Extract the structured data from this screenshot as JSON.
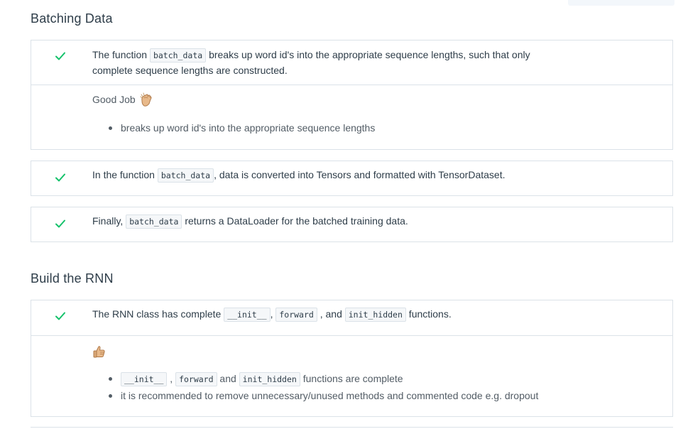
{
  "sections": [
    {
      "title": "Batching Data",
      "criteria": [
        {
          "parts": [
            "The function ",
            "batch_data",
            " breaks up word id's into the appropriate sequence lengths, such that only complete sequence lengths are constructed."
          ],
          "review": {
            "note": "Good Job",
            "note_emoji": "clapping-hands-icon",
            "bullets": [
              "breaks up word id's into the appropriate sequence lengths"
            ]
          }
        },
        {
          "parts": [
            "In the function ",
            "batch_data",
            ", data is converted into Tensors and formatted with TensorDataset."
          ]
        },
        {
          "parts": [
            "Finally, ",
            "batch_data",
            " returns a DataLoader for the batched training data."
          ]
        }
      ]
    },
    {
      "title": "Build the RNN",
      "criteria": [
        {
          "parts": [
            "The RNN class has complete ",
            "__init__",
            ", ",
            "forward",
            " , and ",
            "init_hidden",
            " functions."
          ],
          "review": {
            "note_emoji": "thumbs-up-icon",
            "bullets": [
              {
                "parts": [
                  "__init__",
                  " , ",
                  "forward",
                  " and ",
                  "init_hidden",
                  " functions are complete"
                ]
              },
              "it is recommended to remove unnecessary/unused methods and commented code e.g. dropout"
            ]
          }
        }
      ]
    }
  ],
  "colors": {
    "check": "#02b3e4",
    "check_green": "#15c26b",
    "border": "#dbe2e8",
    "text": "#2e3d49",
    "muted": "#525c65"
  }
}
